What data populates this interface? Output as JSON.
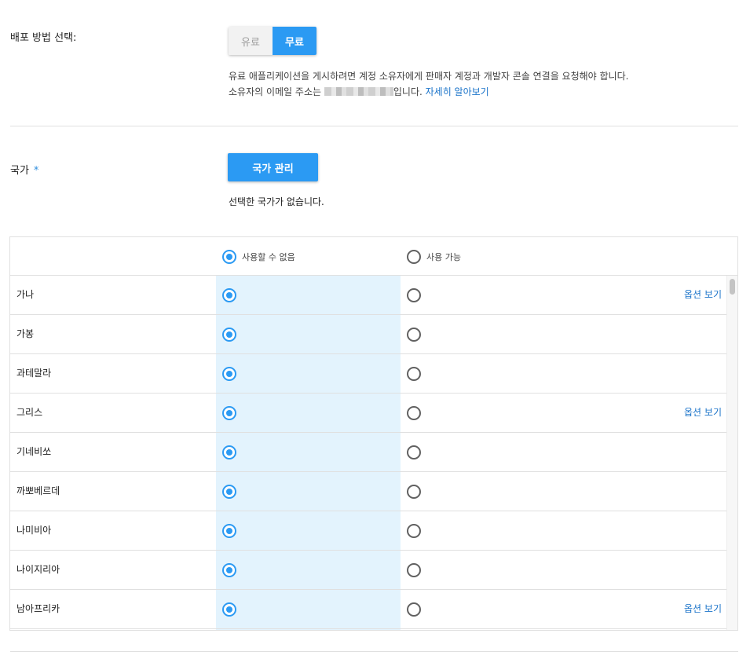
{
  "distribution": {
    "label": "배포 방법 선택:",
    "options": [
      "유료",
      "무료"
    ],
    "selected": "무료",
    "note_line1": "유료 애플리케이션을 게시하려면 계정 소유자에게 판매자 계정과 개발자 콘솔 연결을 요청해야 합니다.",
    "note_line2_prefix": "소유자의 이메일 주소는 ",
    "note_line2_suffix": "입니다. ",
    "learn_more": "자세히 알아보기"
  },
  "country": {
    "label": "국가",
    "required_mark": "*",
    "manage_button": "국가 관리",
    "empty_text": "선택한 국가가 없습니다."
  },
  "table": {
    "header": {
      "unavailable": "사용할 수 없음",
      "available": "사용 가능"
    },
    "rows": [
      {
        "name": "가나",
        "option": "옵션 보기"
      },
      {
        "name": "가봉",
        "option": ""
      },
      {
        "name": "과테말라",
        "option": ""
      },
      {
        "name": "그리스",
        "option": "옵션 보기"
      },
      {
        "name": "기네비쏘",
        "option": ""
      },
      {
        "name": "까뽀베르데",
        "option": ""
      },
      {
        "name": "나미비아",
        "option": ""
      },
      {
        "name": "나이지리아",
        "option": ""
      },
      {
        "name": "남아프리카",
        "option": "옵션 보기"
      }
    ]
  },
  "colors": {
    "accent": "#2b9af3",
    "link": "#1a73c9",
    "column_highlight": "#e3f3fd"
  }
}
